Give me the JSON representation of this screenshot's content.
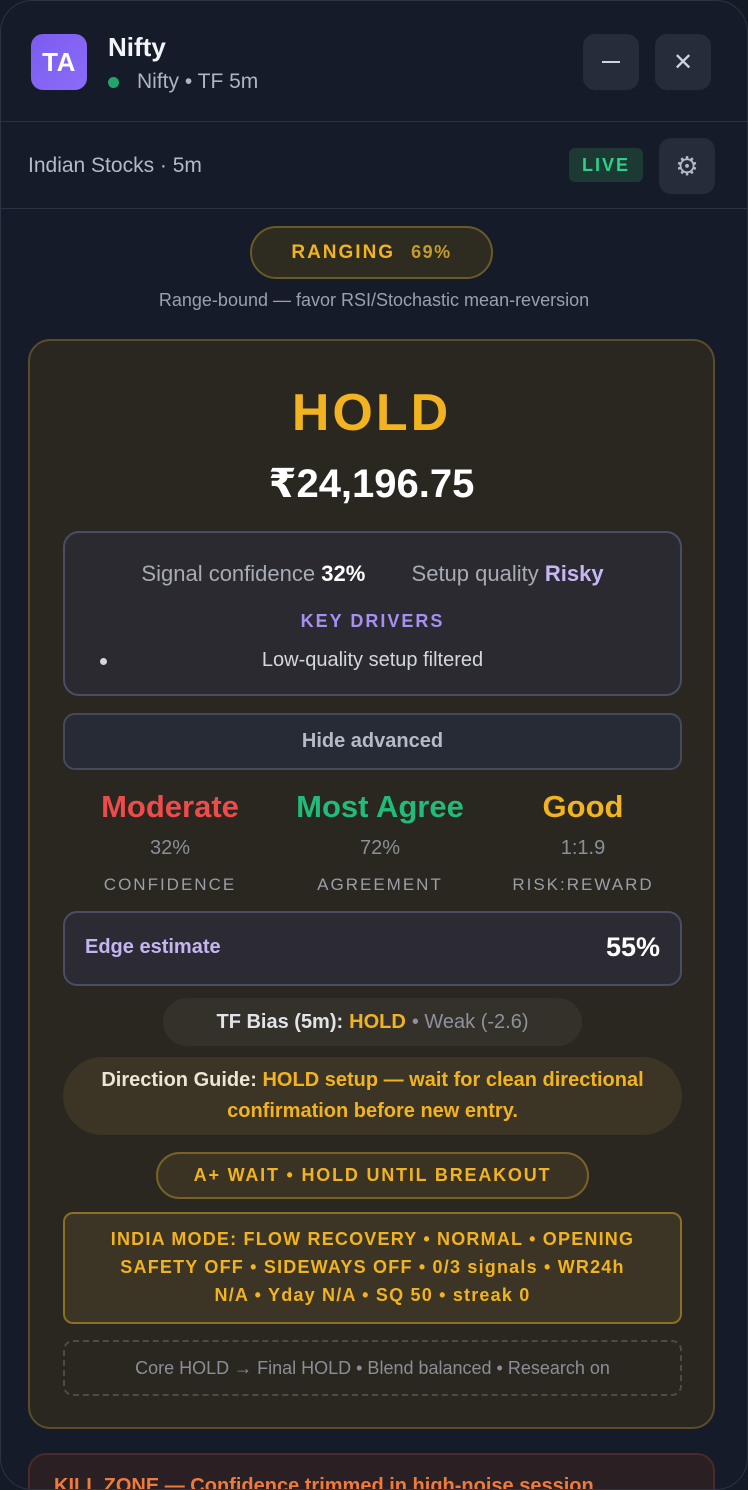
{
  "header": {
    "logo_text": "TA",
    "title": "Nifty",
    "subtitle": "Nifty • TF 5m",
    "status_color": "#22a46b"
  },
  "subheader": {
    "market": "Indian Stocks · 5m",
    "live_badge": "LIVE",
    "settings_icon": "⚙"
  },
  "regime": {
    "name": "RANGING",
    "percent": "69%",
    "description": "Range-bound — favor RSI/Stochastic mean-reversion"
  },
  "signal": {
    "action": "HOLD",
    "price": "₹24,196.75",
    "confidence_label": "Signal confidence",
    "confidence_value": "32%",
    "quality_label": "Setup quality",
    "quality_value": "Risky",
    "key_drivers_title": "KEY DRIVERS",
    "key_drivers": [
      "Low-quality setup filtered"
    ],
    "advanced_button": "Hide advanced"
  },
  "metrics": [
    {
      "headline": "Moderate",
      "value": "32%",
      "label": "CONFIDENCE",
      "color": "#ee4b4b"
    },
    {
      "headline": "Most Agree",
      "value": "72%",
      "label": "AGREEMENT",
      "color": "#21bb7a"
    },
    {
      "headline": "Good",
      "value": "1:1.9",
      "label": "RISK:REWARD",
      "color": "#f2b320"
    }
  ],
  "edge": {
    "label": "Edge estimate",
    "value": "55%"
  },
  "tf_bias": {
    "prefix": "TF Bias (5m):",
    "signal": "HOLD",
    "detail": "• Weak (-2.6)"
  },
  "direction_guide": {
    "prefix": "Direction Guide:",
    "text": "HOLD setup — wait for clean directional confirmation before new entry."
  },
  "aplus": "A+ WAIT • HOLD UNTIL BREAKOUT",
  "india_mode": {
    "line1": "INDIA MODE: FLOW RECOVERY • NORMAL • OPENING",
    "line2": "SAFETY OFF • SIDEWAYS OFF • 0/3 signals • WR24h",
    "line3": "N/A • Yday N/A • SQ 50 • streak 0"
  },
  "pipeline": "Core HOLD → Final HOLD • Blend balanced • Research on",
  "kill_zone": "KILL ZONE — Confidence trimmed in high-noise session"
}
